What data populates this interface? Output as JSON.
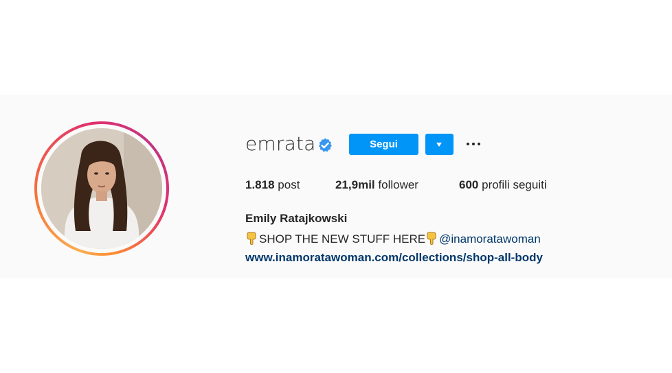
{
  "profile": {
    "username": "emrata",
    "verified": true,
    "follow_label": "Segui",
    "dropdown_icon": "caret-down-icon",
    "more_icon": "more-options-icon",
    "stats": {
      "posts_value": "1.818",
      "posts_label": "post",
      "followers_value": "21,9mil",
      "followers_label": "follower",
      "following_value": "600",
      "following_label": "profili seguiti"
    },
    "full_name": "Emily Ratajkowski",
    "bio": {
      "emoji": "pointing-down-hand-icon",
      "text": "SHOP THE NEW STUFF HERE",
      "mention": "@inamoratawoman"
    },
    "website": "www.inamoratawoman.com/collections/shop-all-body"
  },
  "colors": {
    "primary_button": "#0095f6",
    "verified_badge": "#3897f0",
    "link": "#00376b",
    "band_background": "#fafafa",
    "text": "#262626"
  }
}
